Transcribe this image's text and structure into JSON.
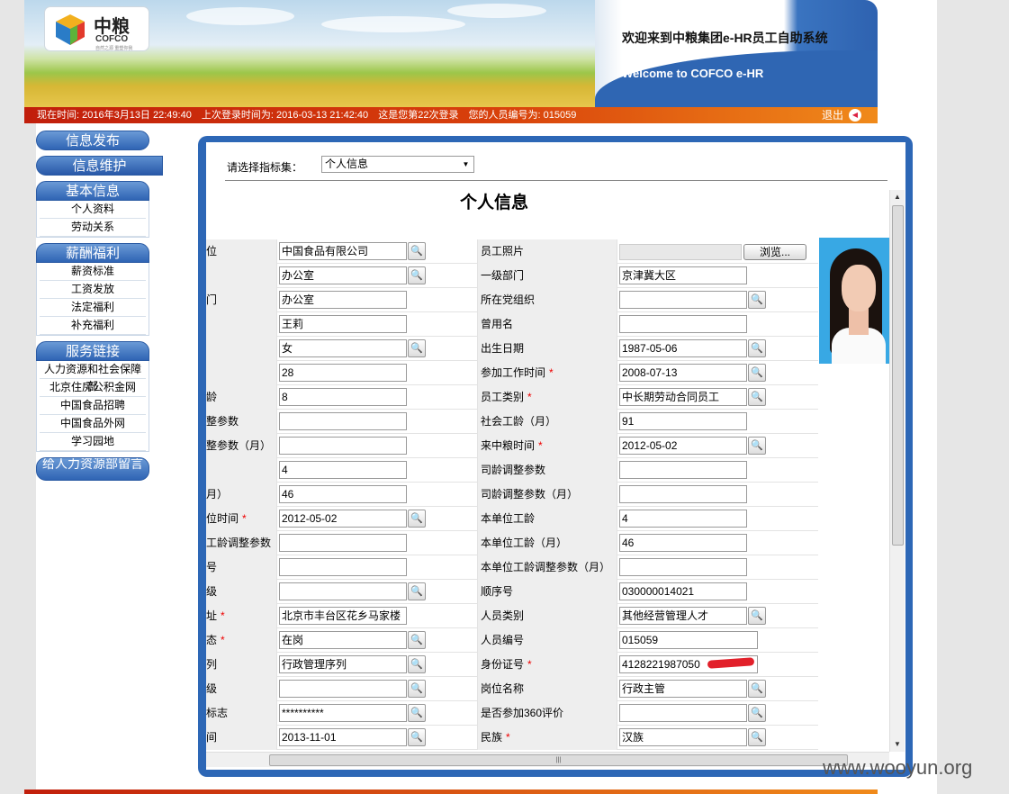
{
  "header": {
    "logo": {
      "cn": "中粮",
      "en": "COFCO",
      "sub": "自然之源 重塑你我"
    },
    "welcome_cn": "欢迎来到中粮集团e-HR员工自助系统",
    "welcome_en": "Welcome to COFCO e-HR"
  },
  "status": {
    "current_time": "现在时间:  2016年3月13日  22:49:40",
    "last_login": "上次登录时间为: 2016-03-13 21:42:40",
    "login_count": "这是您第22次登录",
    "employee_no": "您的人员编号为: 015059",
    "logout": "退出"
  },
  "sidebar": {
    "top_buttons": [
      {
        "label": "信息发布"
      },
      {
        "label": "信息维护"
      }
    ],
    "groups": [
      {
        "title": "基本信息",
        "items": [
          "个人资料",
          "劳动关系"
        ]
      },
      {
        "title": "薪酬福利",
        "items": [
          "薪资标准",
          "工资发放",
          "法定福利",
          "补充福利"
        ]
      },
      {
        "title": "服务链接",
        "items": [
          "人力资源和社会保障部",
          "北京住房公积金网",
          "中国食品招聘",
          "中国食品外网",
          "学习园地"
        ]
      },
      {
        "title": "给人力资源部留言",
        "items": []
      }
    ]
  },
  "main": {
    "selector_label": "请选择指标集：",
    "selector_value": "个人信息",
    "form_title": "个人信息",
    "photo_label": "员工照片",
    "browse_label": "浏览...",
    "rows": [
      {
        "l1": "位",
        "v1": "中国食品有限公司",
        "m1": true,
        "r1": false,
        "l2": "员工照片",
        "photo": true
      },
      {
        "l1": "",
        "v1": "办公室",
        "m1": true,
        "r1": false,
        "l2": "一级部门",
        "v2": "京津冀大区",
        "m2": false,
        "r2": false
      },
      {
        "l1": "门",
        "v1": "办公室",
        "m1": false,
        "r1": false,
        "l2": "所在党组织",
        "v2": "",
        "m2": true,
        "r2": false
      },
      {
        "l1": "",
        "v1": "王莉",
        "m1": false,
        "r1": false,
        "l2": "曾用名",
        "v2": "",
        "m2": false,
        "r2": false
      },
      {
        "l1": "",
        "v1": "女",
        "m1": true,
        "r1": false,
        "l2": "出生日期",
        "v2": "1987-05-06",
        "m2": true,
        "r2": false
      },
      {
        "l1": "",
        "v1": "28",
        "m1": false,
        "r1": false,
        "l2": "参加工作时间",
        "v2": "2008-07-13",
        "m2": true,
        "r2": true
      },
      {
        "l1": "龄",
        "v1": "8",
        "m1": false,
        "r1": false,
        "l2": "员工类别",
        "v2": "中长期劳动合同员工",
        "m2": true,
        "r2": true
      },
      {
        "l1": "整参数",
        "v1": "",
        "m1": false,
        "r1": false,
        "l2": "社会工龄（月）",
        "v2": "91",
        "m2": false,
        "r2": false
      },
      {
        "l1": "整参数（月）",
        "v1": "",
        "m1": false,
        "r1": false,
        "l2": "来中粮时间",
        "v2": "2012-05-02",
        "m2": true,
        "r2": true
      },
      {
        "l1": "",
        "v1": "4",
        "m1": false,
        "r1": false,
        "l2": "司龄调整参数",
        "v2": "",
        "m2": false,
        "r2": false
      },
      {
        "l1": "月）",
        "v1": "46",
        "m1": false,
        "r1": false,
        "l2": "司龄调整参数（月）",
        "v2": "",
        "m2": false,
        "r2": false
      },
      {
        "l1": "位时间",
        "v1": "2012-05-02",
        "m1": true,
        "r1": true,
        "l2": "本单位工龄",
        "v2": "4",
        "m2": false,
        "r2": false
      },
      {
        "l1": "工龄调整参数",
        "v1": "",
        "m1": false,
        "r1": false,
        "l2": "本单位工龄（月）",
        "v2": "46",
        "m2": false,
        "r2": false
      },
      {
        "l1": "号",
        "v1": "",
        "m1": false,
        "r1": false,
        "l2": "本单位工龄调整参数（月）",
        "v2": "",
        "m2": false,
        "r2": false
      },
      {
        "l1": "级",
        "v1": "",
        "m1": true,
        "r1": false,
        "l2": "顺序号",
        "v2": "030000014021",
        "m2": false,
        "r2": false
      },
      {
        "l1": "址",
        "v1": "北京市丰台区花乡马家楼",
        "m1": false,
        "r1": true,
        "l2": "人员类别",
        "v2": "其他经营管理人才",
        "m2": true,
        "r2": false
      },
      {
        "l1": "态",
        "v1": "在岗",
        "m1": true,
        "r1": true,
        "l2": "人员编号",
        "v2": "015059",
        "m2": false,
        "r2": false,
        "wide2": true
      },
      {
        "l1": "列",
        "v1": "行政管理序列",
        "m1": true,
        "r1": false,
        "l2": "身份证号",
        "v2": "4128221987050",
        "m2": false,
        "r2": true,
        "wide2": true,
        "redact": true
      },
      {
        "l1": "级",
        "v1": "",
        "m1": true,
        "r1": false,
        "l2": "岗位名称",
        "v2": "行政主管",
        "m2": true,
        "r2": false
      },
      {
        "l1": "标志",
        "v1": "**********",
        "m1": true,
        "r1": false,
        "l2": "是否参加360评价",
        "v2": "",
        "m2": true,
        "r2": false
      },
      {
        "l1": "间",
        "v1": "2013-11-01",
        "m1": true,
        "r1": false,
        "l2": "民族",
        "v2": "汉族",
        "m2": true,
        "r2": true
      }
    ]
  },
  "watermark": "www.wooyun.org",
  "colors": {
    "brand_blue": "#2d67b6",
    "status_red": "#c11e0b",
    "status_orange": "#f08a1a"
  }
}
